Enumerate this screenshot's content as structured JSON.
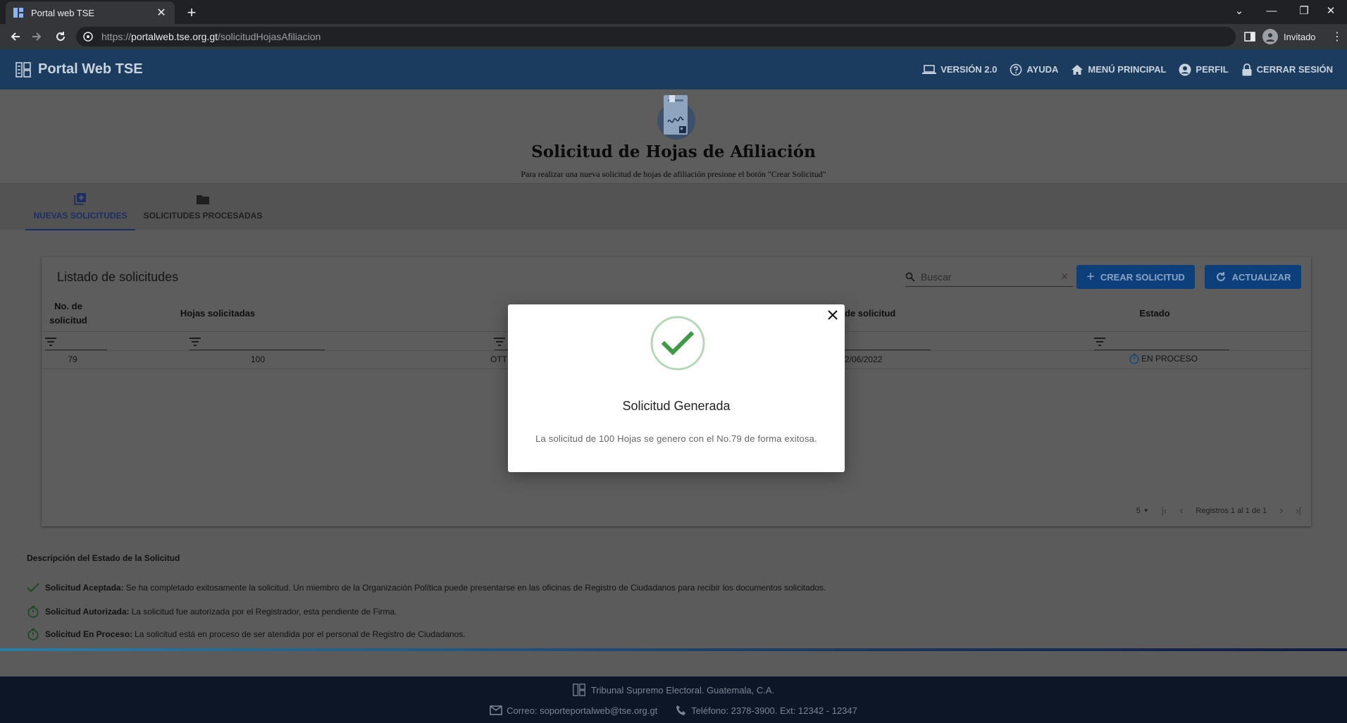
{
  "browser": {
    "tab_title": "Portal web TSE",
    "url_scheme": "https://",
    "url_host": "portalweb.tse.org.gt",
    "url_path": "/solicitudHojasAfiliacion",
    "profile_label": "Invitado"
  },
  "header": {
    "brand": "Portal Web TSE",
    "nav": [
      {
        "label": "VERSIÓN 2.0",
        "icon": "laptop-icon"
      },
      {
        "label": "AYUDA",
        "icon": "help-icon"
      },
      {
        "label": "MENÚ PRINCIPAL",
        "icon": "home-icon"
      },
      {
        "label": "PERFIL",
        "icon": "account-icon"
      },
      {
        "label": "CERRAR SESIÓN",
        "icon": "lock-icon"
      }
    ]
  },
  "page": {
    "title": "Solicitud de Hojas de Afiliación",
    "subtitle": "Para realizar una nueva solicitud de hojas de afiliación presione el botón \"Crear Solicitud\"",
    "tabs": [
      {
        "label": "NUEVAS SOLICITUDES",
        "icon": "library-add-icon"
      },
      {
        "label": "SOLICITUDES PROCESADAS",
        "icon": "folder-icon"
      }
    ]
  },
  "table": {
    "title": "Listado de solicitudes",
    "search_placeholder": "Buscar",
    "create_button": "CREAR SOLICITUD",
    "refresh_button": "ACTUALIZAR",
    "columns": {
      "numero_line1": "No. de",
      "numero_line2": "solicitud",
      "hojas": "Hojas solicitadas",
      "fecha": "de solicitud",
      "estado": "Estado"
    },
    "rows": [
      {
        "numero": "79",
        "hojas": "100",
        "tipo": "OTT",
        "fecha": "2/06/2022",
        "estado": "EN PROCESO"
      }
    ],
    "pager": {
      "page_size": "5",
      "records": "Registros 1 al 1 de 1"
    }
  },
  "legend": {
    "title": "Descripción del Estado de la Solicitud",
    "items": [
      {
        "label": "Solicitud Aceptada:",
        "text": "Se ha completado exitosamente la solicitud. Un miembro de la Organización Política puede presentarse en las oficinas de Registro de Ciudadanos para recibir los documentos solicitados.",
        "icon": "check-icon"
      },
      {
        "label": "Solicitud Autorizada:",
        "text": "La solicitud fue autorizada por el Registrador, esta pendiente de Firma.",
        "icon": "timer-icon"
      },
      {
        "label": "Solicitud En Proceso:",
        "text": "La solicitud está en proceso de ser atendida por el personal de Registro de Ciudadanos.",
        "icon": "timer-icon"
      }
    ]
  },
  "footer": {
    "org": "Tribunal Supremo Electoral. Guatemala, C.A.",
    "email": "Correo: soporteportalweb@tse.org.gt",
    "phone": "Teléfono: 2378-3900. Ext: 12342 - 12347"
  },
  "modal": {
    "title": "Solicitud Generada",
    "message": "La solicitud de 100 Hojas se genero con el No.79 de forma exitosa."
  },
  "colors": {
    "appbar": "#1b3c5e",
    "primary_button": "#0d3f7a",
    "success_green": "#3f9a48",
    "footer": "#0c1627"
  }
}
